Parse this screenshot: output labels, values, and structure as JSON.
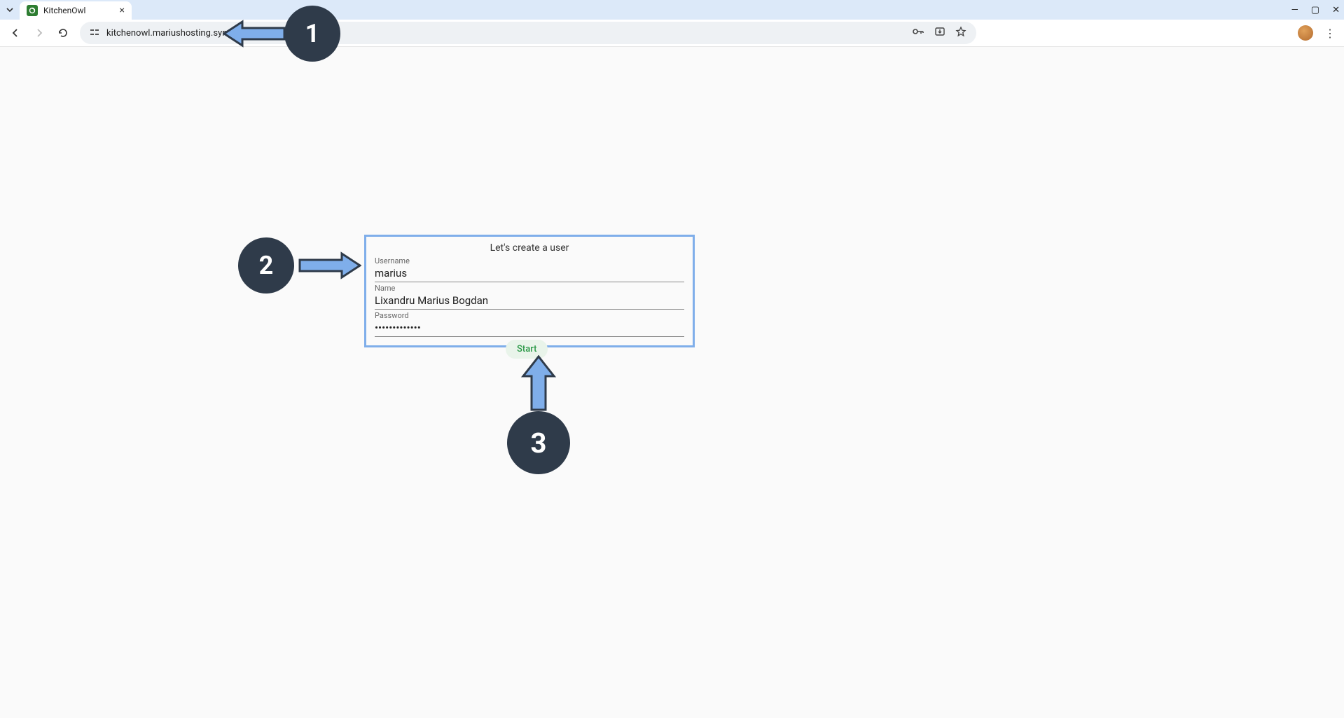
{
  "browser": {
    "tab_title": "KitchenOwl",
    "url": "kitchenowl.mariushosting.synology.me"
  },
  "form": {
    "title": "Let's create a user",
    "username_label": "Username",
    "username_value": "marius",
    "name_label": "Name",
    "name_value": "Lixandru Marius Bogdan",
    "password_label": "Password",
    "password_value": "•••••••••••••"
  },
  "buttons": {
    "start": "Start"
  },
  "callouts": {
    "c1": "1",
    "c2": "2",
    "c3": "3"
  }
}
